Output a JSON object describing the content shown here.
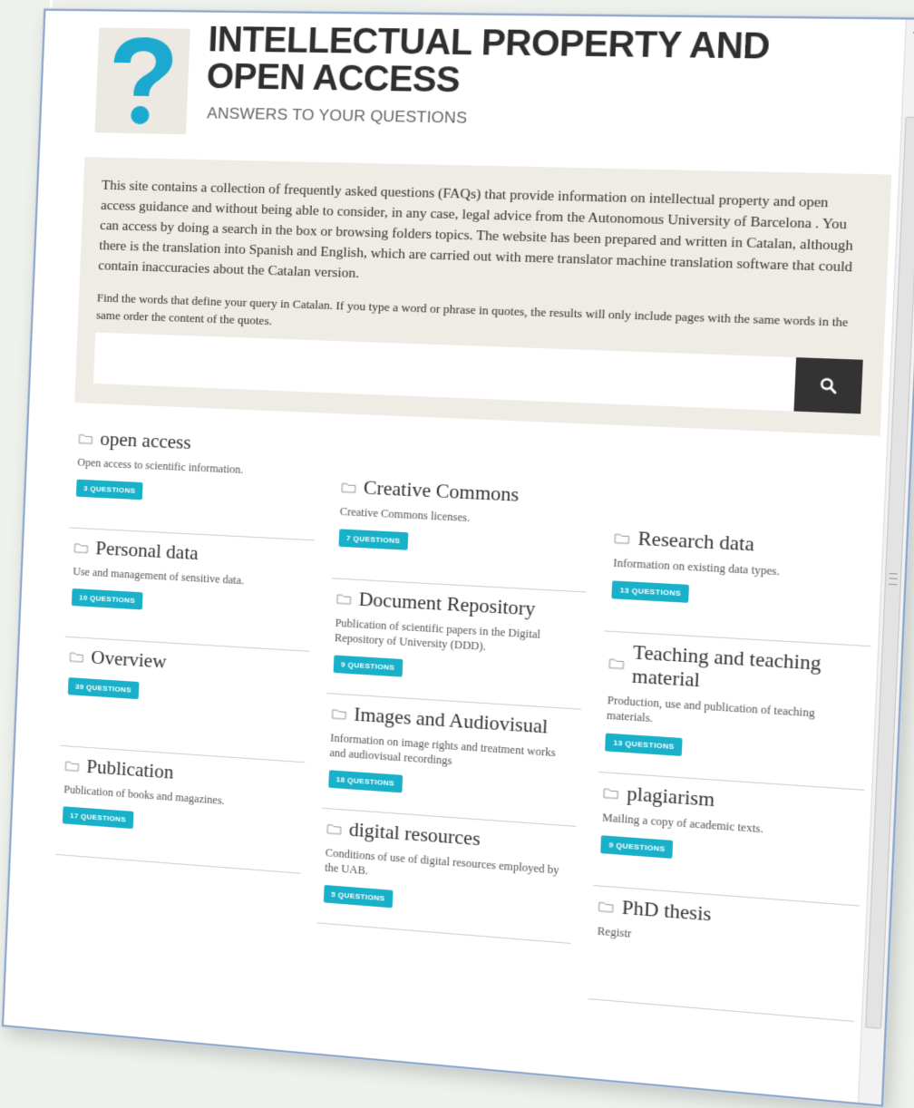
{
  "header": {
    "title": "INTELLECTUAL PROPERTY AND OPEN ACCESS",
    "subtitle": "ANSWERS TO YOUR QUESTIONS"
  },
  "intro": {
    "paragraph": "This site contains a collection of frequently asked questions (FAQs) that provide information on intellectual property and open access guidance and without being able to consider, in any case, legal advice from the Autonomous University of Barcelona . You can access by doing a search in the box or browsing folders topics. The website has been prepared and written in Catalan, although there is the translation into Spanish and English, which are carried out with mere translator machine translation software that could contain inaccuracies about the Catalan version.",
    "search_help": "Find the words that define your query in Catalan. If you type a word or phrase in quotes, the results will only include pages with the same words in the same order the content of the quotes."
  },
  "search": {
    "placeholder": "",
    "button_icon": "search-icon"
  },
  "categories": [
    {
      "title": "open access",
      "desc": "Open access to scientific information.",
      "count": "3 QUESTIONS"
    },
    {
      "title": "Creative Commons",
      "desc": "Creative Commons licenses.",
      "count": "7 QUESTIONS"
    },
    {
      "title": "Research data",
      "desc": "Information on existing data types.",
      "count": "13 QUESTIONS"
    },
    {
      "title": "Personal data",
      "desc": "Use and management of sensitive data.",
      "count": "10 QUESTIONS"
    },
    {
      "title": "Document Repository",
      "desc": "Publication of scientific papers in the Digital Repository of University (DDD).",
      "count": "9 QUESTIONS"
    },
    {
      "title": "Teaching and teaching material",
      "desc": "Production, use and publication of teaching materials.",
      "count": "13 QUESTIONS"
    },
    {
      "title": "Overview",
      "desc": "",
      "count": "39 QUESTIONS"
    },
    {
      "title": "Images and Audiovisual",
      "desc": "Information on image rights and treatment works and audiovisual recordings",
      "count": "18 QUESTIONS"
    },
    {
      "title": "plagiarism",
      "desc": "Mailing a copy of academic texts.",
      "count": "9 QUESTIONS"
    },
    {
      "title": "Publication",
      "desc": "Publication of books and magazines.",
      "count": "17 QUESTIONS"
    },
    {
      "title": "digital resources",
      "desc": "Conditions of use of digital resources employed by the UAB.",
      "count": "5 QUESTIONS"
    },
    {
      "title": "PhD thesis",
      "desc": "Registr",
      "count": ""
    }
  ],
  "colors": {
    "badge": "#19b0c9",
    "logo_question_mark": "#1ba9d0",
    "search_button": "#333333"
  }
}
